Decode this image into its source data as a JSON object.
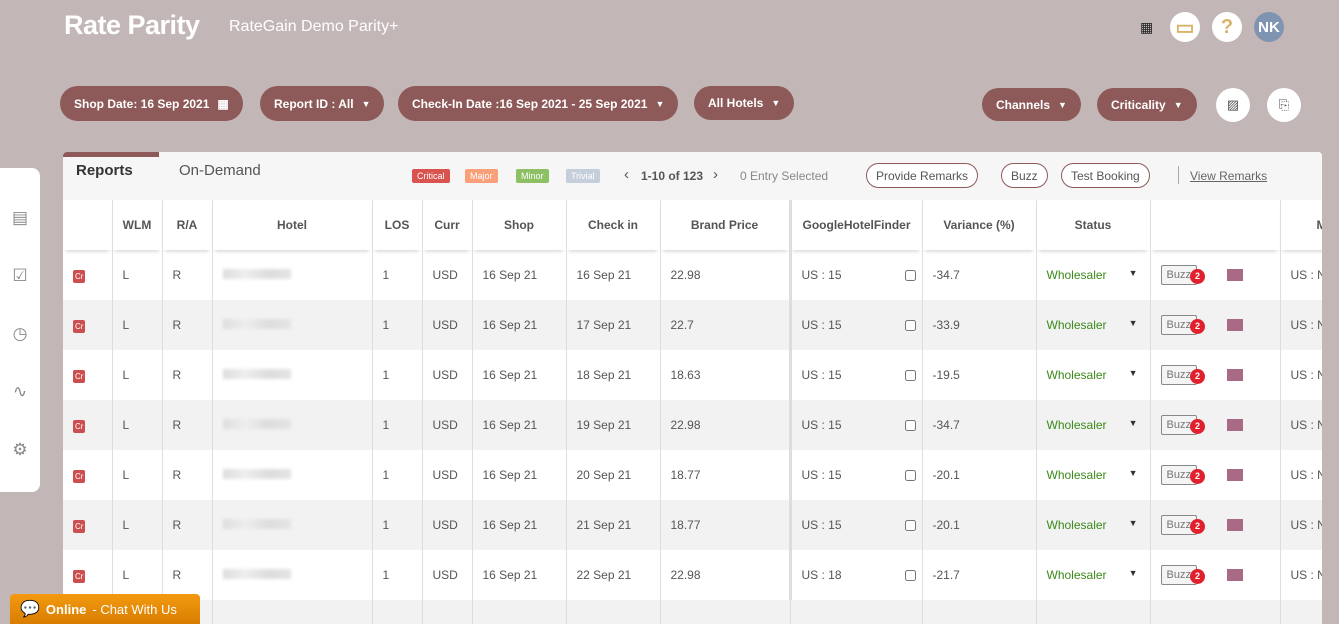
{
  "header": {
    "logo": "Rate Parity",
    "app": "RateGain Demo Parity+",
    "avatar": "NK",
    "help": "?"
  },
  "filters": {
    "shop_date": "Shop Date: 16 Sep 2021",
    "report_id": "Report ID : All",
    "checkin": "Check-In Date :16 Sep 2021 - 25 Sep 2021",
    "hotels": "All Hotels",
    "channels": "Channels",
    "criticality": "Criticality"
  },
  "toolbar": {
    "tab_reports": "Reports",
    "tab_ondemand": "On-Demand",
    "legend": [
      "Critical",
      "Major",
      "Minor",
      "Trivial"
    ],
    "legend_colors": [
      "#d9534f",
      "#f9a07a",
      "#8cc063",
      "#c5cfdc"
    ],
    "pagination": "1-10 of 123",
    "selected": "0 Entry Selected",
    "provide_remarks": "Provide Remarks",
    "buzz": "Buzz",
    "test_booking": "Test Booking",
    "view_remarks": "View Remarks"
  },
  "columns": [
    "",
    "WLM",
    "R/A",
    "Hotel",
    "LOS",
    "Curr",
    "Shop",
    "Check in",
    "Brand Price",
    "GoogleHotelFinder",
    "Variance (%)",
    "Status",
    "",
    "M"
  ],
  "rows": [
    {
      "crit": "Cr",
      "wlm": "L",
      "ra": "R",
      "los": "1",
      "curr": "USD",
      "shop": "16 Sep 21",
      "checkin": "16 Sep 21",
      "brand": "22.98",
      "ghf": "US : 15",
      "var": "-34.7",
      "status": "Wholesaler",
      "buzz": "Buzz",
      "count": "2",
      "m": "US : N"
    },
    {
      "crit": "Cr",
      "wlm": "L",
      "ra": "R",
      "los": "1",
      "curr": "USD",
      "shop": "16 Sep 21",
      "checkin": "17 Sep 21",
      "brand": "22.7",
      "ghf": "US : 15",
      "var": "-33.9",
      "status": "Wholesaler",
      "buzz": "Buzz",
      "count": "2",
      "m": "US : N"
    },
    {
      "crit": "Cr",
      "wlm": "L",
      "ra": "R",
      "los": "1",
      "curr": "USD",
      "shop": "16 Sep 21",
      "checkin": "18 Sep 21",
      "brand": "18.63",
      "ghf": "US : 15",
      "var": "-19.5",
      "status": "Wholesaler",
      "buzz": "Buzz",
      "count": "2",
      "m": "US : N"
    },
    {
      "crit": "Cr",
      "wlm": "L",
      "ra": "R",
      "los": "1",
      "curr": "USD",
      "shop": "16 Sep 21",
      "checkin": "19 Sep 21",
      "brand": "22.98",
      "ghf": "US : 15",
      "var": "-34.7",
      "status": "Wholesaler",
      "buzz": "Buzz",
      "count": "2",
      "m": "US : N"
    },
    {
      "crit": "Cr",
      "wlm": "L",
      "ra": "R",
      "los": "1",
      "curr": "USD",
      "shop": "16 Sep 21",
      "checkin": "20 Sep 21",
      "brand": "18.77",
      "ghf": "US : 15",
      "var": "-20.1",
      "status": "Wholesaler",
      "buzz": "Buzz",
      "count": "2",
      "m": "US : N"
    },
    {
      "crit": "Cr",
      "wlm": "L",
      "ra": "R",
      "los": "1",
      "curr": "USD",
      "shop": "16 Sep 21",
      "checkin": "21 Sep 21",
      "brand": "18.77",
      "ghf": "US : 15",
      "var": "-20.1",
      "status": "Wholesaler",
      "buzz": "Buzz",
      "count": "2",
      "m": "US : N"
    },
    {
      "crit": "Cr",
      "wlm": "L",
      "ra": "R",
      "los": "1",
      "curr": "USD",
      "shop": "16 Sep 21",
      "checkin": "22 Sep 21",
      "brand": "22.98",
      "ghf": "US : 18",
      "var": "-21.7",
      "status": "Wholesaler",
      "buzz": "Buzz",
      "count": "2",
      "m": "US : N"
    }
  ],
  "chat": {
    "online": "Online",
    "text": " - Chat With Us"
  }
}
